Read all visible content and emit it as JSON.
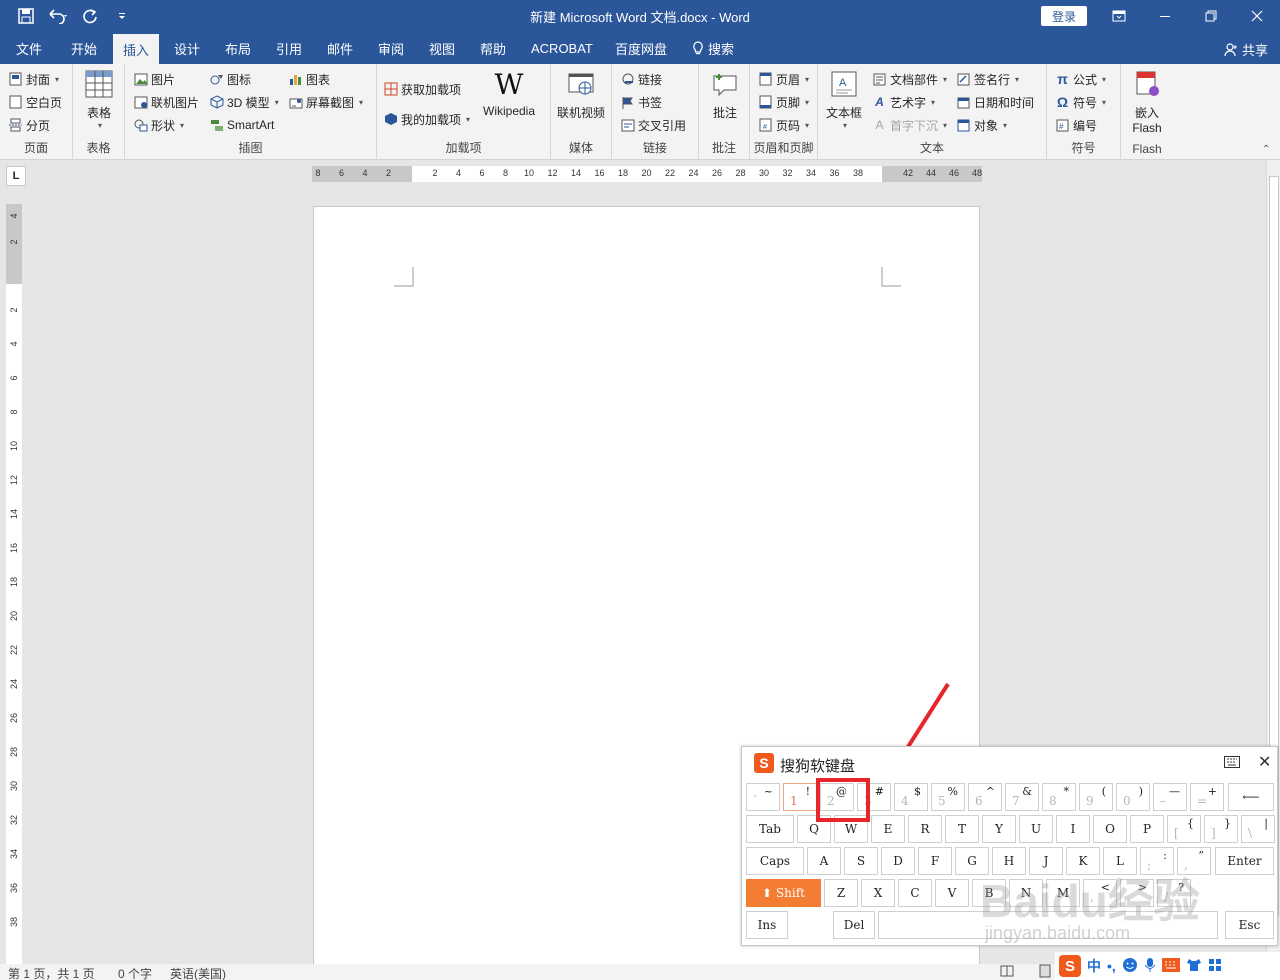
{
  "window": {
    "title": "新建 Microsoft Word 文档.docx  -  Word",
    "login": "登录"
  },
  "tabs": [
    "文件",
    "开始",
    "插入",
    "设计",
    "布局",
    "引用",
    "邮件",
    "审阅",
    "视图",
    "帮助",
    "ACROBAT",
    "百度网盘",
    "搜索"
  ],
  "active_tab": "插入",
  "share": "共享",
  "ribbon": {
    "pages": {
      "cover": "封面",
      "blank": "空白页",
      "break": "分页",
      "label": "页面"
    },
    "tables": {
      "table": "表格",
      "label": "表格"
    },
    "illustrations": {
      "picture": "图片",
      "online_picture": "联机图片",
      "shapes": "形状",
      "icons": "图标",
      "model3d": "3D 模型",
      "smartart": "SmartArt",
      "chart": "图表",
      "screenshot": "屏幕截图",
      "label": "插图"
    },
    "addins": {
      "get": "获取加载项",
      "my": "我的加载项",
      "wikipedia": "Wikipedia",
      "label": "加载项"
    },
    "media": {
      "online_video": "联机视频",
      "label": "媒体"
    },
    "links": {
      "link": "链接",
      "bookmark": "书签",
      "cross_ref": "交叉引用",
      "label": "链接"
    },
    "comments": {
      "comment": "批注",
      "label": "批注"
    },
    "header_footer": {
      "header": "页眉",
      "footer": "页脚",
      "page_number": "页码",
      "label": "页眉和页脚"
    },
    "text": {
      "textbox": "文本框",
      "quick_parts": "文档部件",
      "wordart": "艺术字",
      "dropcap": "首字下沉",
      "signature": "签名行",
      "datetime": "日期和时间",
      "object": "对象",
      "label": "文本"
    },
    "symbols": {
      "equation": "公式",
      "symbol": "符号",
      "number": "编号",
      "label": "符号"
    },
    "flash": {
      "embed_line1": "嵌入",
      "embed_line2": "Flash",
      "label": "Flash"
    }
  },
  "hruler_ticks": [
    "8",
    "6",
    "4",
    "2",
    "2",
    "4",
    "6",
    "8",
    "10",
    "12",
    "14",
    "16",
    "18",
    "20",
    "22",
    "24",
    "26",
    "28",
    "30",
    "32",
    "34",
    "36",
    "38",
    "42",
    "44",
    "46",
    "48"
  ],
  "vruler_ticks": [
    "4",
    "2",
    "2",
    "4",
    "6",
    "8",
    "10",
    "12",
    "14",
    "16",
    "18",
    "20",
    "22",
    "24",
    "26",
    "28",
    "30",
    "32",
    "34",
    "36",
    "38"
  ],
  "softkb": {
    "title": "搜狗软键盘",
    "row1": [
      {
        "up": "~",
        "low": "`"
      },
      {
        "up": "!",
        "low": "1"
      },
      {
        "up": "@",
        "low": "2"
      },
      {
        "up": "#",
        "low": "3"
      },
      {
        "up": "$",
        "low": "4"
      },
      {
        "up": "%",
        "low": "5"
      },
      {
        "up": "^",
        "low": "6"
      },
      {
        "up": "&",
        "low": "7"
      },
      {
        "up": "*",
        "low": "8"
      },
      {
        "up": "(",
        "low": "9"
      },
      {
        "up": ")",
        "low": "0"
      },
      {
        "up": "—",
        "low": "–"
      },
      {
        "up": "+",
        "low": "="
      }
    ],
    "backspace": "⟵",
    "row2": [
      "Tab",
      "Q",
      "W",
      "E",
      "R",
      "T",
      "Y",
      "U",
      "I",
      "O",
      "P"
    ],
    "row2_sym": [
      {
        "up": "{",
        "low": "["
      },
      {
        "up": "}",
        "low": "]"
      },
      {
        "up": "|",
        "low": "\\"
      }
    ],
    "row3": [
      "Caps",
      "A",
      "S",
      "D",
      "F",
      "G",
      "H",
      "J",
      "K",
      "L"
    ],
    "row3_sym": [
      {
        "up": ":",
        "low": ";"
      },
      {
        "up": "”",
        "low": ","
      }
    ],
    "enter": "Enter",
    "row4": [
      "Shift",
      "Z",
      "X",
      "C",
      "V",
      "B",
      "N",
      "M"
    ],
    "row4_sym": [
      {
        "up": "<",
        "low": ","
      },
      {
        "up": ">",
        "low": "."
      },
      {
        "up": "?",
        "low": "/"
      }
    ],
    "ins": "Ins",
    "del": "Del",
    "esc": "Esc"
  },
  "watermark": {
    "logo": "Baidu经验",
    "url": "jingyan.baidu.com"
  },
  "statusbar": {
    "page": "第 1 页，共 1 页",
    "words": "0 个字",
    "lang": "英语(美国)"
  },
  "ime": {
    "mode": "中"
  },
  "colors": {
    "accent": "#2b579a",
    "highlight": "#e8262a",
    "sogou": "#ef5a1c"
  }
}
